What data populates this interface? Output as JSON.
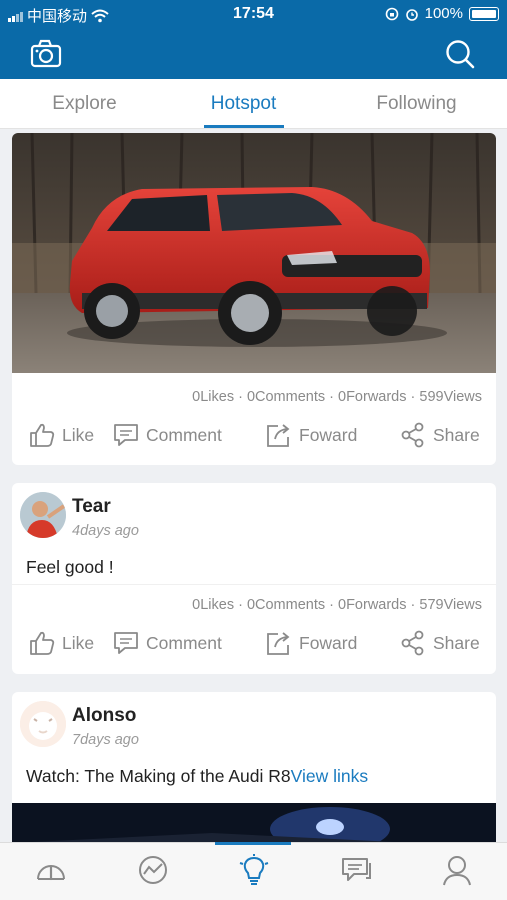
{
  "status": {
    "carrier": "中国移动",
    "time": "17:54",
    "battery": "100%"
  },
  "header": {
    "camera_icon": "camera-icon",
    "search_icon": "search-icon"
  },
  "tabs": [
    {
      "label": "Explore",
      "active": false
    },
    {
      "label": "Hotspot",
      "active": true
    },
    {
      "label": "Following",
      "active": false
    }
  ],
  "posts": [
    {
      "image": "red-suv-photo",
      "stats": "0Likes · 0Comments · 0Forwards · 599Views",
      "actions": {
        "like": "Like",
        "comment": "Comment",
        "forward": "Foward",
        "share": "Share"
      }
    },
    {
      "user": "Tear",
      "time": "4days ago",
      "text": "Feel good !",
      "stats": "0Likes · 0Comments · 0Forwards · 579Views",
      "actions": {
        "like": "Like",
        "comment": "Comment",
        "forward": "Foward",
        "share": "Share"
      }
    },
    {
      "user": "Alonso",
      "time": "7days ago",
      "text": "Watch: The Making of the Audi R8",
      "link": "View links",
      "image": "video-thumbnail"
    }
  ],
  "bottom_nav": [
    {
      "name": "dashboard-icon",
      "active": false
    },
    {
      "name": "trend-icon",
      "active": false
    },
    {
      "name": "lightbulb-icon",
      "active": true
    },
    {
      "name": "messages-icon",
      "active": false
    },
    {
      "name": "profile-icon",
      "active": false
    }
  ],
  "colors": {
    "header": "#0a6aa8",
    "accent": "#1a7bbf",
    "muted": "#8a8a8a"
  }
}
